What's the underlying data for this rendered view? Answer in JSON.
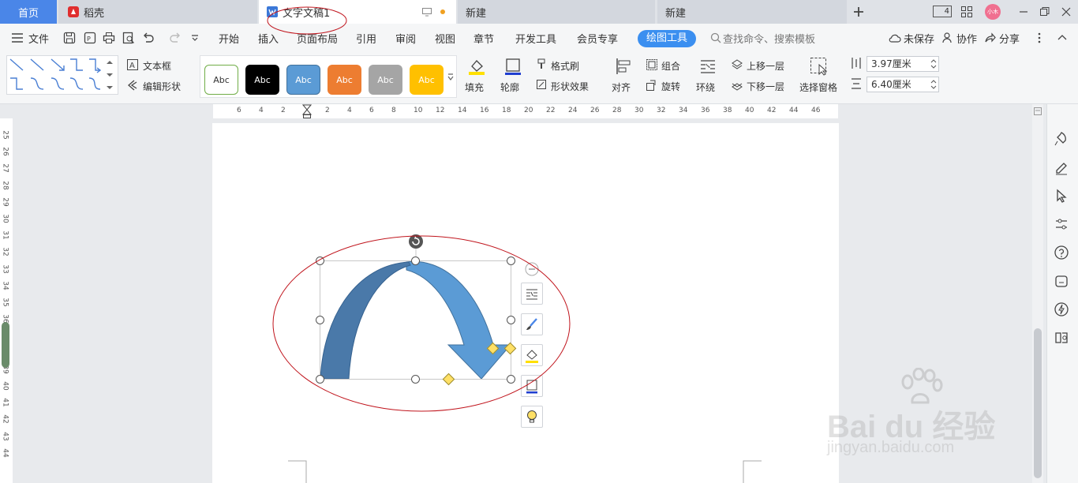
{
  "tabs": {
    "home": "首页",
    "daoke": "稻壳",
    "doc": "文字文稿1",
    "new1": "新建",
    "new2": "新建"
  },
  "window": {
    "avatar_text": "小木",
    "win_count": "4"
  },
  "menu": {
    "file": "文件",
    "items": [
      "开始",
      "插入",
      "页面布局",
      "引用",
      "审阅",
      "视图",
      "章节",
      "开发工具",
      "会员专享"
    ],
    "active": "绘图工具",
    "search_placeholder": "查找命令、搜索模板",
    "unsaved": "未保存",
    "collab": "协作",
    "share": "分享"
  },
  "ribbon": {
    "textbox": "文本框",
    "edit_shape": "编辑形状",
    "styles": [
      "Abc",
      "Abc",
      "Abc",
      "Abc",
      "Abc",
      "Abc"
    ],
    "fill": "填充",
    "outline": "轮廓",
    "format_brush": "格式刷",
    "shape_effect": "形状效果",
    "align": "对齐",
    "group": "组合",
    "rotate": "旋转",
    "wrap": "环绕",
    "bring_forward": "上移一层",
    "send_backward": "下移一层",
    "selection_pane": "选择窗格",
    "height": "3.97厘米",
    "width": "6.40厘米"
  },
  "ruler": {
    "h_ticks": [
      "6",
      "4",
      "2",
      "2",
      "4",
      "6",
      "8",
      "10",
      "12",
      "14",
      "16",
      "18",
      "20",
      "22",
      "24",
      "26",
      "28",
      "30",
      "32",
      "34",
      "36",
      "38",
      "40",
      "42",
      "44",
      "46"
    ],
    "v_ticks": [
      "25",
      "26",
      "27",
      "28",
      "29",
      "30",
      "31",
      "32",
      "33",
      "34",
      "35",
      "36",
      "37",
      "38",
      "39",
      "40",
      "41",
      "42",
      "43",
      "44"
    ]
  },
  "watermark": {
    "brand": "Bai du 经验",
    "url": "jingyan.baidu.com"
  },
  "colors": {
    "accent": "#3b8ff0",
    "arrow_dark": "#4a79a9",
    "arrow_light": "#5b9bd5",
    "annotation": "#c0141c"
  }
}
